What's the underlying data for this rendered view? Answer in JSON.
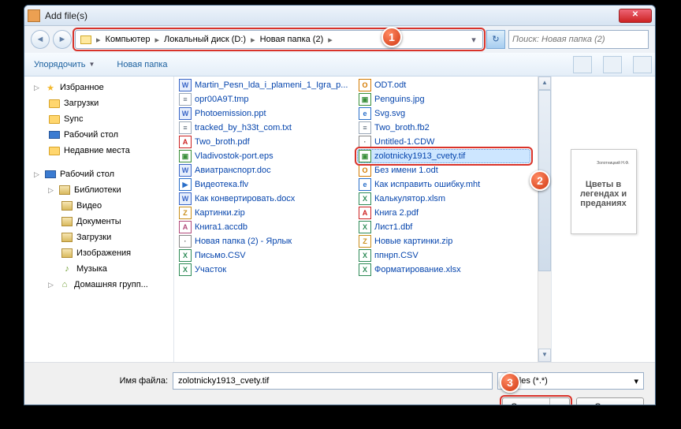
{
  "title": "Add file(s)",
  "breadcrumb": [
    "Компьютер",
    "Локальный диск (D:)",
    "Новая папка (2)"
  ],
  "search_placeholder": "Поиск: Новая папка (2)",
  "toolbar": {
    "organize": "Упорядочить",
    "newfolder": "Новая папка"
  },
  "nav": {
    "favorites": "Избранное",
    "downloads": "Загрузки",
    "sync": "Sync",
    "desktop": "Рабочий стол",
    "recent": "Недавние места",
    "desktop2": "Рабочий стол",
    "libraries": "Библиотеки",
    "video": "Видео",
    "documents": "Документы",
    "downloads2": "Загрузки",
    "images": "Изображения",
    "music": "Музыка",
    "homegroup": "Домашняя групп..."
  },
  "col1": [
    {
      "k": "doc",
      "t": "Martin_Pesn_lda_i_plameni_1_Igra_p..."
    },
    {
      "k": "txt",
      "t": "opr00A9T.tmp"
    },
    {
      "k": "doc",
      "t": "Photoemission.ppt"
    },
    {
      "k": "txt",
      "t": "tracked_by_h33t_com.txt"
    },
    {
      "k": "pdf",
      "t": "Two_broth.pdf"
    },
    {
      "k": "img",
      "t": "Vladivostok-port.eps"
    },
    {
      "k": "doc",
      "t": "Авиатранспорт.doc"
    },
    {
      "k": "media",
      "t": "Видеотека.flv"
    },
    {
      "k": "doc",
      "t": "Как конвертировать.docx"
    },
    {
      "k": "zip",
      "t": "Картинки.zip"
    },
    {
      "k": "db",
      "t": "Книга1.accdb"
    },
    {
      "k": "gen",
      "t": "Новая папка (2) - Ярлык"
    },
    {
      "k": "xls",
      "t": "Письмо.CSV"
    },
    {
      "k": "xls",
      "t": "Участок"
    }
  ],
  "col2": [
    {
      "k": "odt",
      "t": "ODT.odt"
    },
    {
      "k": "img",
      "t": "Penguins.jpg"
    },
    {
      "k": "web",
      "t": "Svg.svg"
    },
    {
      "k": "txt",
      "t": "Two_broth.fb2"
    },
    {
      "k": "gen",
      "t": "Untitled-1.CDW"
    },
    {
      "k": "img",
      "t": "zolotnicky1913_cvety.tif",
      "sel": true
    },
    {
      "k": "odt",
      "t": "Без имени 1.odt"
    },
    {
      "k": "web",
      "t": "Как исправить ошибку.mht"
    },
    {
      "k": "xls",
      "t": "Калькулятор.xlsm"
    },
    {
      "k": "pdf",
      "t": "Книга 2.pdf"
    },
    {
      "k": "xls",
      "t": "Лист1.dbf"
    },
    {
      "k": "zip",
      "t": "Новые картинки.zip"
    },
    {
      "k": "xls",
      "t": "ппнрп.CSV"
    },
    {
      "k": "xls",
      "t": "Форматирование.xlsx"
    }
  ],
  "preview": {
    "author": "Золотницкий Н.Ф.",
    "title": "Цветы в легендах и преданиях"
  },
  "footer": {
    "label": "Имя файла:",
    "value": "zolotnicky1913_cvety.tif",
    "filter": "All files (*.*)",
    "open": "Открыть",
    "cancel": "Отмена"
  },
  "callouts": {
    "c1": "1",
    "c2": "2",
    "c3": "3"
  }
}
